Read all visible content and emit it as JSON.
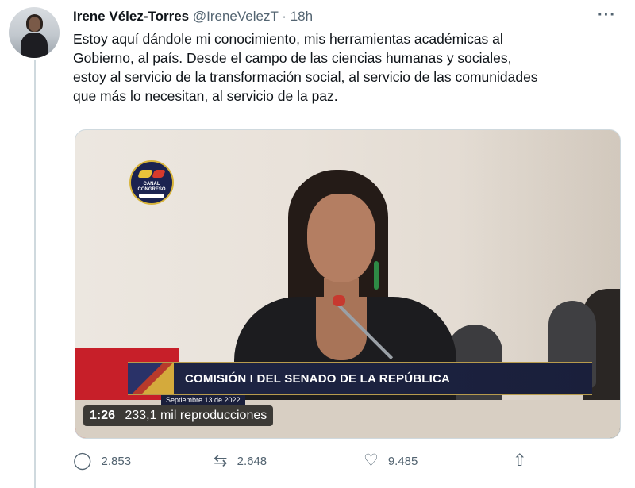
{
  "tweet": {
    "author_name": "Irene Vélez-Torres",
    "author_handle": "@IreneVelezT",
    "separator": "·",
    "time": "18h",
    "more_label": "···",
    "text_lines": [
      "Estoy aquí dándole mi conocimiento, mis herramientas académicas al",
      "Gobierno, al país. Desde el campo de las ciencias humanas y sociales,",
      "estoy al servicio de la transformación social, al servicio de las comunidades",
      "que más lo necesitan, al servicio de la paz."
    ]
  },
  "video": {
    "logo_text": "CANAL CONGRESO",
    "banner_text": "COMISIÓN I DEL SENADO DE LA REPÚBLICA",
    "banner_date": "Septiembre 13 de 2022",
    "duration": "1:26",
    "views": "233,1 mil reproducciones"
  },
  "actions": {
    "reply": {
      "icon": "reply-icon",
      "glyph": "◯",
      "count": "2.853"
    },
    "retweet": {
      "icon": "retweet-icon",
      "glyph": "⇆",
      "count": "2.648"
    },
    "like": {
      "icon": "heart-icon",
      "glyph": "♡",
      "count": "9.485"
    },
    "share": {
      "icon": "share-icon",
      "glyph": "⇧"
    }
  },
  "colors": {
    "text_primary": "#0f1419",
    "text_secondary": "#536471",
    "banner_bg": "#1e2544",
    "banner_border": "#b79b4d"
  }
}
